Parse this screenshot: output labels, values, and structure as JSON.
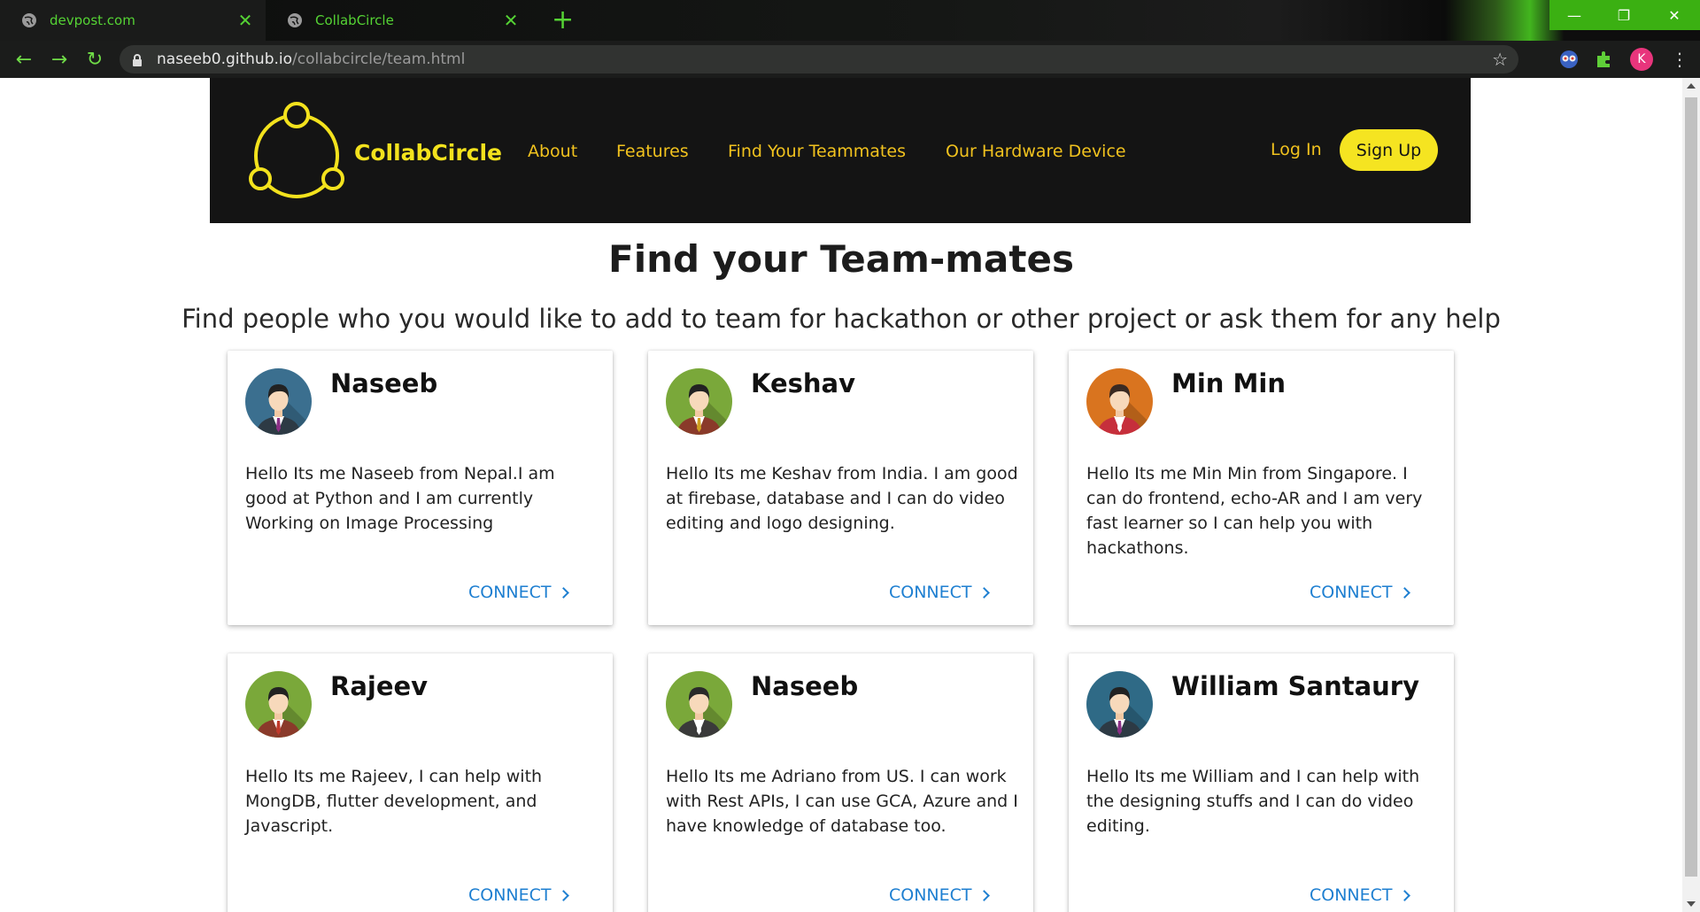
{
  "browser": {
    "tabs": [
      {
        "label": "devpost.com"
      },
      {
        "label": "CollabCircle"
      }
    ],
    "url_host": "naseeb0.github.io",
    "url_path": "/collabcircle/team.html",
    "profile_initial": "K"
  },
  "header": {
    "brand": "CollabCircle",
    "nav": [
      "About",
      "Features",
      "Find Your Teammates",
      "Our Hardware Device"
    ],
    "login": "Log In",
    "signup": "Sign Up"
  },
  "page": {
    "title": "Find your Team-mates",
    "subtitle": "Find people who you would like to add to team for hackathon or other project or ask them for any help"
  },
  "cards": [
    {
      "name": "Naseeb",
      "text": "Hello Its me Naseeb from Nepal.I am good at Python and I am currently Working on Image Processing",
      "connect": "CONNECT",
      "avatar_bg": "#3b6f8f",
      "avatar_hair": "#222222",
      "avatar_suit": "#2d3a44",
      "avatar_tie": "#8b2f86"
    },
    {
      "name": "Keshav",
      "text": "Hello Its me Keshav from India. I am good at firebase, database and I can do video editing and logo designing.",
      "connect": "CONNECT",
      "avatar_bg": "#7aa83a",
      "avatar_hair": "#222222",
      "avatar_suit": "#8a3a2a",
      "avatar_tie": "#d0a020"
    },
    {
      "name": "Min Min",
      "text": "Hello Its me Min Min from Singapore. I can do frontend, echo-AR and I am very fast learner so I can help you with hackathons.",
      "connect": "CONNECT",
      "avatar_bg": "#d9741f",
      "avatar_hair": "#3a2a22",
      "avatar_suit": "#c62f3c",
      "avatar_tie": "#ffffff"
    },
    {
      "name": "Rajeev",
      "text": "Hello Its me Rajeev, I can help with MongDB, flutter development, and Javascript.",
      "connect": "CONNECT",
      "avatar_bg": "#7aa83a",
      "avatar_hair": "#222222",
      "avatar_suit": "#8a3a2a",
      "avatar_tie": "#c0392b"
    },
    {
      "name": "Naseeb",
      "text": "Hello Its me Adriano from US. I can work with Rest APIs, I can use GCA, Azure and I have knowledge of database too.",
      "connect": "CONNECT",
      "avatar_bg": "#7aa83a",
      "avatar_hair": "#2a2a2a",
      "avatar_suit": "#3a3a3a",
      "avatar_tie": "#ffffff"
    },
    {
      "name": "William Santaury",
      "text": "Hello Its me William and I can help with the designing stuffs and I can do video editing.",
      "connect": "CONNECT",
      "avatar_bg": "#2f6a86",
      "avatar_hair": "#222222",
      "avatar_suit": "#2d3a44",
      "avatar_tie": "#8b2f86"
    }
  ]
}
